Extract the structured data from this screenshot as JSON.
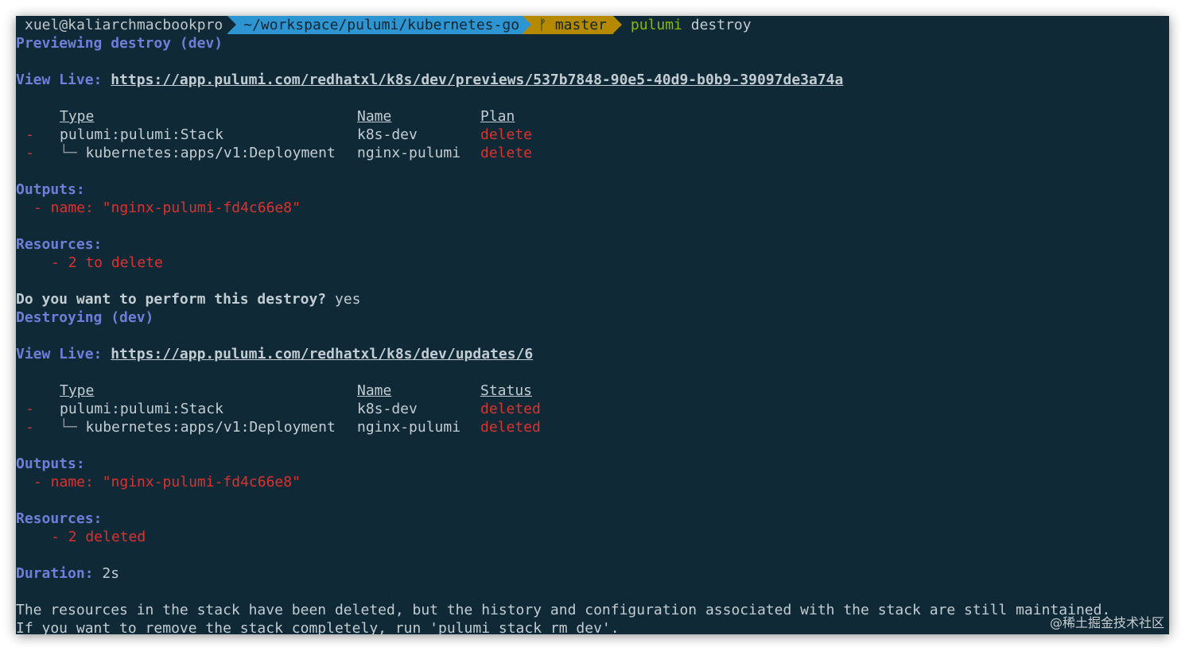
{
  "prompt": {
    "user": "xuel@kaliarchmacbookpro",
    "path": "~/workspace/pulumi/kubernetes-go",
    "branch_icon": "ᚠ",
    "branch": "master",
    "command_bin": "pulumi",
    "command_args": "destroy"
  },
  "preview": {
    "title": "Previewing destroy (dev)",
    "view_live_label": "View Live:",
    "view_live_url": "https://app.pulumi.com/redhatxl/k8s/dev/previews/537b7848-90e5-40d9-b0b9-39097de3a74a",
    "table": {
      "headers": {
        "type": "Type",
        "name": "Name",
        "third": "Plan"
      },
      "rows": [
        {
          "mark": "-",
          "tree": "",
          "type": "pulumi:pulumi:Stack",
          "name": "k8s-dev",
          "value": "delete"
        },
        {
          "mark": "-",
          "tree": "└─ ",
          "type": "kubernetes:apps/v1:Deployment",
          "name": "nginx-pulumi",
          "value": "delete"
        }
      ]
    },
    "outputs_label": "Outputs:",
    "output_line": "- name: \"nginx-pulumi-fd4c66e8\"",
    "resources_label": "Resources:",
    "resources_line": "- 2 to delete"
  },
  "confirm": {
    "question": "Do you want to perform this destroy?",
    "answer": "yes"
  },
  "destroy": {
    "title": "Destroying (dev)",
    "view_live_label": "View Live:",
    "view_live_url": "https://app.pulumi.com/redhatxl/k8s/dev/updates/6",
    "table": {
      "headers": {
        "type": "Type",
        "name": "Name",
        "third": "Status"
      },
      "rows": [
        {
          "mark": "-",
          "tree": "",
          "type": "pulumi:pulumi:Stack",
          "name": "k8s-dev",
          "value": "deleted"
        },
        {
          "mark": "-",
          "tree": "└─ ",
          "type": "kubernetes:apps/v1:Deployment",
          "name": "nginx-pulumi",
          "value": "deleted"
        }
      ]
    },
    "outputs_label": "Outputs:",
    "output_line": "- name: \"nginx-pulumi-fd4c66e8\"",
    "resources_label": "Resources:",
    "resources_line": "- 2 deleted",
    "duration_label": "Duration:",
    "duration_value": "2s"
  },
  "footer": {
    "line1": "The resources in the stack have been deleted, but the history and configuration associated with the stack are still maintained.",
    "line2": "If you want to remove the stack completely, run 'pulumi stack rm dev'."
  },
  "watermark": "@稀土掘金技术社区",
  "colors": {
    "background": "#0f2a36",
    "header_blue": "#6f7ed8",
    "delete_red": "#dc322f",
    "path_segment": "#2e95d3",
    "git_segment": "#b58900",
    "command_green": "#8cb800"
  }
}
